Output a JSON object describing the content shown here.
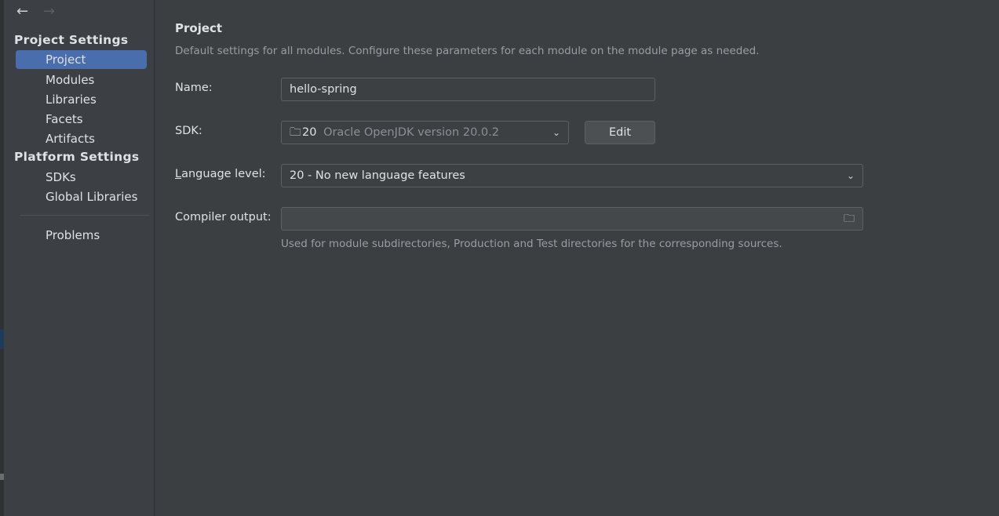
{
  "sidebar": {
    "groups": [
      {
        "label": "Project Settings",
        "items": [
          {
            "label": "Project",
            "selected": true
          },
          {
            "label": "Modules"
          },
          {
            "label": "Libraries"
          },
          {
            "label": "Facets"
          },
          {
            "label": "Artifacts"
          }
        ]
      },
      {
        "label": "Platform Settings",
        "items": [
          {
            "label": "SDKs"
          },
          {
            "label": "Global Libraries"
          }
        ]
      }
    ],
    "problems": "Problems",
    "selected_color": "#4a6dad"
  },
  "main": {
    "title": "Project",
    "description": "Default settings for all modules. Configure these parameters for each module on the module page as needed.",
    "name_label": "Name:",
    "name_value": "hello-spring",
    "sdk_label": "SDK:",
    "sdk_version": "20",
    "sdk_name": "Oracle OpenJDK version 20.0.2",
    "edit_label": "Edit",
    "language_label_mnemonic": "L",
    "language_label_rest": "anguage level:",
    "language_value": "20 - No new language features",
    "compiler_label": "Compiler output:",
    "compiler_value": "",
    "compiler_hint": "Used for module subdirectories, Production and Test directories for the corresponding sources."
  }
}
